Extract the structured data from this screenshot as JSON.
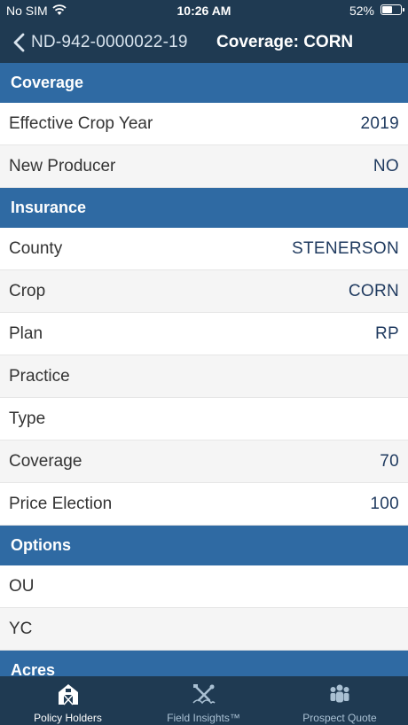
{
  "status": {
    "carrier": "No SIM",
    "time": "10:26 AM",
    "battery": "52%",
    "battery_level": 0.52
  },
  "nav": {
    "back_label": "ND-942-0000022-19",
    "title": "Coverage: CORN"
  },
  "sections": {
    "coverage": {
      "title": "Coverage",
      "rows": [
        {
          "label": "Effective Crop Year",
          "value": "2019"
        },
        {
          "label": "New Producer",
          "value": "NO"
        }
      ]
    },
    "insurance": {
      "title": "Insurance",
      "rows": [
        {
          "label": "County",
          "value": "STENERSON"
        },
        {
          "label": "Crop",
          "value": "CORN"
        },
        {
          "label": "Plan",
          "value": "RP"
        },
        {
          "label": "Practice",
          "value": ""
        },
        {
          "label": "Type",
          "value": ""
        },
        {
          "label": "Coverage",
          "value": "70"
        },
        {
          "label": "Price Election",
          "value": "100"
        }
      ]
    },
    "options": {
      "title": "Options",
      "rows": [
        {
          "label": "OU",
          "value": ""
        },
        {
          "label": "YC",
          "value": ""
        }
      ]
    },
    "acres": {
      "title": "Acres"
    }
  },
  "tabs": [
    {
      "label": "Policy Holders",
      "icon": "barn-icon",
      "active": true
    },
    {
      "label": "Field Insights™",
      "icon": "field-tools-icon",
      "active": false
    },
    {
      "label": "Prospect Quote",
      "icon": "people-group-icon",
      "active": false
    }
  ],
  "colors": {
    "nav_bg": "#1f3a52",
    "section_bg": "#2f6aa3",
    "value_text": "#1f3a5f"
  }
}
